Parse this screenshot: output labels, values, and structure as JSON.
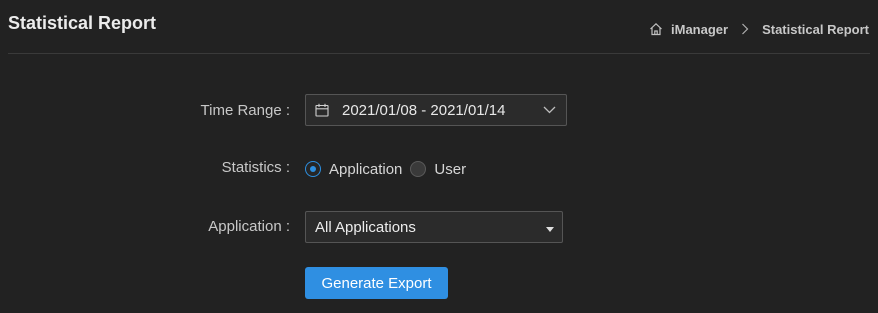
{
  "header": {
    "title": "Statistical Report",
    "breadcrumb": {
      "home_icon": "home-icon",
      "items": [
        "iManager",
        "Statistical Report"
      ],
      "separator_icon": "chevron-right-icon"
    }
  },
  "form": {
    "time_range": {
      "label": "Time Range :",
      "value": "2021/01/08 - 2021/01/14",
      "icon": "calendar-icon",
      "dropdown_icon": "chevron-down-icon"
    },
    "statistics": {
      "label": "Statistics :",
      "options": [
        {
          "label": "Application",
          "checked": true
        },
        {
          "label": "User",
          "checked": false
        }
      ]
    },
    "application": {
      "label": "Application :",
      "selected": "All Applications",
      "dropdown_icon": "caret-down-icon"
    },
    "generate_button": "Generate Export"
  },
  "colors": {
    "background": "#222222",
    "accent": "#2f8fe2",
    "input_border": "#555555",
    "divider": "#3a3a3a"
  }
}
